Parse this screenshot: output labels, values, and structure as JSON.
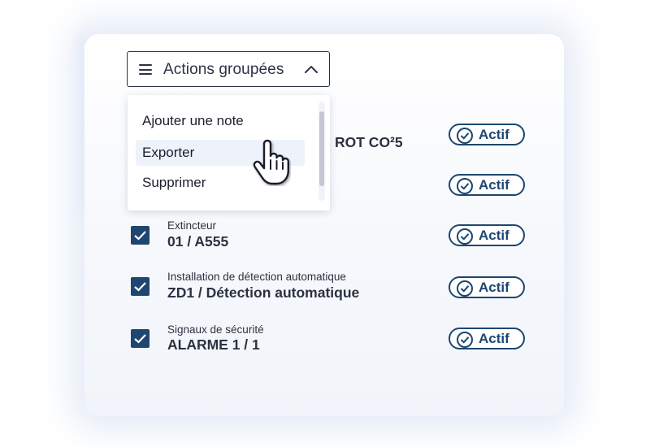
{
  "toolbar": {
    "actions_label": "Actions groupées",
    "actions_icon": "hamburger-menu-icon",
    "chevron_icon": "chevron-up-icon"
  },
  "dropdown": {
    "items": [
      {
        "label": "Ajouter une note"
      },
      {
        "label": "Exporter"
      },
      {
        "label": "Supprimer"
      }
    ],
    "hovered_item": "Exporter"
  },
  "rows": [
    {
      "category": "",
      "identifier": "ROT CO²5",
      "status": "Actif",
      "checked": true
    },
    {
      "category": "",
      "identifier": "",
      "status": "Actif",
      "checked": true
    },
    {
      "category": "Extincteur",
      "identifier": "01 / A555",
      "status": "Actif",
      "checked": true
    },
    {
      "category": "Installation de détection automatique",
      "identifier": "ZD1 / Détection automatique",
      "status": "Actif",
      "checked": true
    },
    {
      "category": "Signaux de sécurité",
      "identifier": "ALARME 1 / 1",
      "status": "Actif",
      "checked": true
    }
  ],
  "colors": {
    "primary": "#1e4670",
    "text": "#2c3140",
    "hover": "#eef2fa"
  }
}
